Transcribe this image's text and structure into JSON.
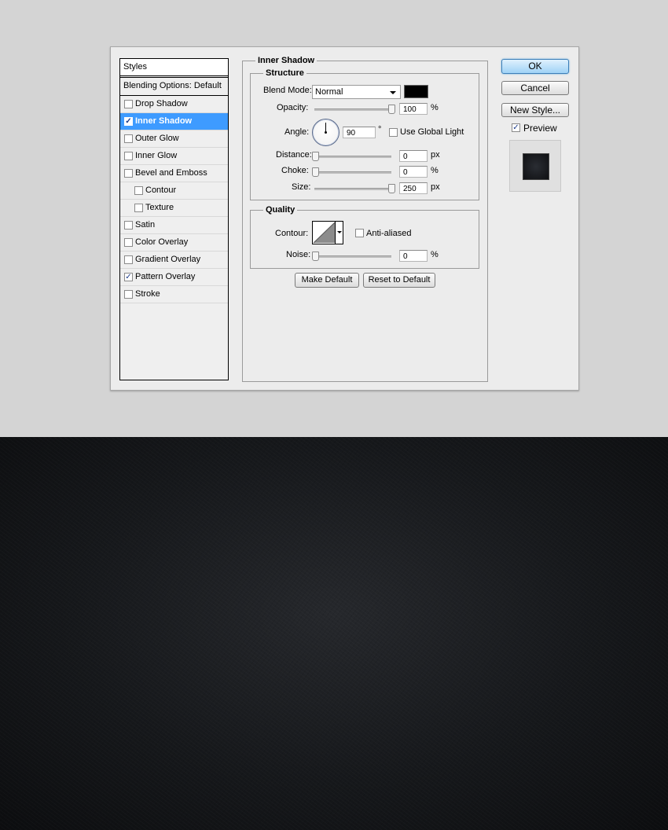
{
  "styles_panel": {
    "header": "Styles",
    "blending": "Blending Options: Default",
    "items": [
      {
        "label": "Drop Shadow",
        "checked": false
      },
      {
        "label": "Inner Shadow",
        "checked": true
      },
      {
        "label": "Outer Glow",
        "checked": false
      },
      {
        "label": "Inner Glow",
        "checked": false
      },
      {
        "label": "Bevel and Emboss",
        "checked": false
      },
      {
        "label": "Contour",
        "checked": false
      },
      {
        "label": "Texture",
        "checked": false
      },
      {
        "label": "Satin",
        "checked": false
      },
      {
        "label": "Color Overlay",
        "checked": false
      },
      {
        "label": "Gradient Overlay",
        "checked": false
      },
      {
        "label": "Pattern Overlay",
        "checked": true
      },
      {
        "label": "Stroke",
        "checked": false
      }
    ],
    "check_glyph": "✓"
  },
  "inner_shadow": {
    "title": "Inner Shadow",
    "structure": {
      "title": "Structure",
      "blend_mode_label": "Blend Mode:",
      "blend_mode_value": "Normal",
      "shadow_color": "#000000",
      "opacity_label": "Opacity:",
      "opacity_value": "100",
      "opacity_unit": "%",
      "angle_label": "Angle:",
      "angle_value": "90",
      "angle_unit": "°",
      "global_light_label": "Use Global Light",
      "distance_label": "Distance:",
      "distance_value": "0",
      "distance_unit": "px",
      "choke_label": "Choke:",
      "choke_value": "0",
      "choke_unit": "%",
      "size_label": "Size:",
      "size_value": "250",
      "size_unit": "px"
    },
    "quality": {
      "title": "Quality",
      "contour_label": "Contour:",
      "anti_aliased_label": "Anti-aliased",
      "noise_label": "Noise:",
      "noise_value": "0",
      "noise_unit": "%"
    },
    "make_default": "Make Default",
    "reset_default": "Reset to Default"
  },
  "buttons": {
    "ok": "OK",
    "cancel": "Cancel",
    "new_style": "New Style...",
    "preview_label": "Preview",
    "preview_check": "✓"
  },
  "colors": {
    "selection": "#3e9bff",
    "dialog_bg": "#ececec",
    "page_bg": "#d4d4d4",
    "dark_bg": "#16181b"
  }
}
